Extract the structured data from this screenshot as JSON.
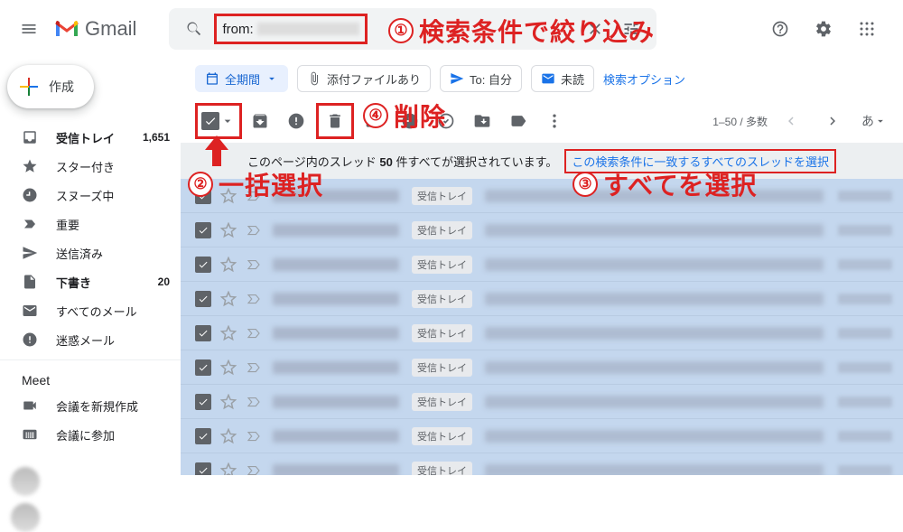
{
  "header": {
    "logo_text": "Gmail",
    "search_prefix": "from:"
  },
  "chips": {
    "period": "全期間",
    "attachment": "添付ファイルあり",
    "to": "To: 自分",
    "unread": "未読",
    "options": "検索オプション"
  },
  "toolbar": {
    "range": "1–50 / 多数",
    "lang": "あ"
  },
  "banner": {
    "prefix": "このページ内のスレッド ",
    "count": "50",
    "suffix": " 件すべてが選択されています。",
    "select_all": "この検索条件に一致するすべてのスレッドを選択"
  },
  "sidebar": {
    "compose": "作成",
    "items": [
      {
        "label": "受信トレイ",
        "count": "1,651",
        "bold": true,
        "icon": "inbox"
      },
      {
        "label": "スター付き",
        "icon": "star"
      },
      {
        "label": "スヌーズ中",
        "icon": "clock"
      },
      {
        "label": "重要",
        "icon": "important"
      },
      {
        "label": "送信済み",
        "icon": "send"
      },
      {
        "label": "下書き",
        "count": "20",
        "bold": true,
        "icon": "file"
      },
      {
        "label": "すべてのメール",
        "icon": "mail"
      },
      {
        "label": "迷惑メール",
        "icon": "spam"
      }
    ],
    "meet": "Meet",
    "meet_items": [
      {
        "label": "会議を新規作成",
        "icon": "video"
      },
      {
        "label": "会議に参加",
        "icon": "keyboard"
      }
    ]
  },
  "messages": {
    "label": "受信トレイ",
    "rows": 9
  },
  "annotations": {
    "a1": {
      "num": "①",
      "text": "検索条件で絞り込み"
    },
    "a2": {
      "num": "②",
      "text": "一括選択"
    },
    "a3": {
      "num": "③",
      "text": "すべてを選択"
    },
    "a4": {
      "num": "④",
      "text": "削除"
    }
  }
}
